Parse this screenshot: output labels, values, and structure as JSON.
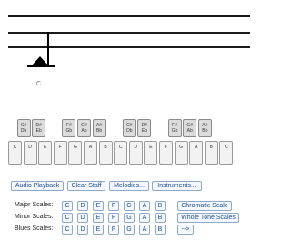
{
  "staff": {
    "note_label": "C"
  },
  "keyboard": {
    "white_keys": [
      "C",
      "D",
      "E",
      "F",
      "G",
      "A",
      "B",
      "C",
      "D",
      "E",
      "F",
      "G",
      "A",
      "B",
      "C"
    ],
    "black_keys": [
      {
        "sharp": "C#",
        "flat": "Db"
      },
      {
        "sharp": "D#",
        "flat": "Eb"
      },
      {
        "sharp": "F#",
        "flat": "Gb"
      },
      {
        "sharp": "G#",
        "flat": "Ab"
      },
      {
        "sharp": "A#",
        "flat": "Bb"
      },
      {
        "sharp": "C#",
        "flat": "Db"
      },
      {
        "sharp": "D#",
        "flat": "Eb"
      },
      {
        "sharp": "F#",
        "flat": "Gb"
      },
      {
        "sharp": "G#",
        "flat": "Ab"
      },
      {
        "sharp": "A#",
        "flat": "Bb"
      }
    ]
  },
  "controls": {
    "audio_playback": "Audio Playback",
    "clear_staff": "Clear Staff",
    "melodies": "Melodies...",
    "instruments": "Instruments..."
  },
  "scales": {
    "major_label": "Major Scales:",
    "minor_label": "Minor Scales:",
    "blues_label": "Blues Scales:",
    "notes": [
      "C",
      "D",
      "E",
      "F",
      "G",
      "A",
      "B"
    ],
    "chromatic": "Chromatic Scale",
    "whole_tone": "Whole Tone Scales",
    "more": "-->"
  }
}
